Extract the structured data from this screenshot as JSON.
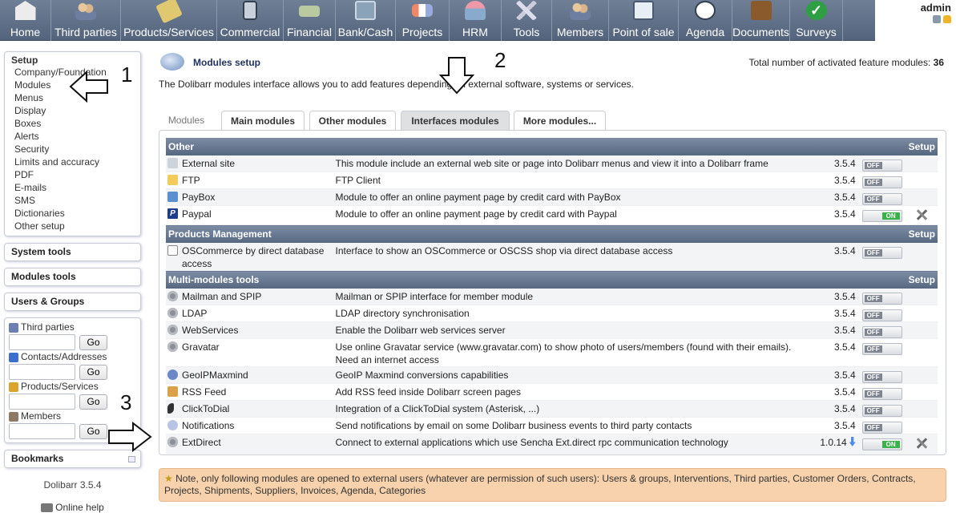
{
  "menu": [
    {
      "id": "home",
      "label": "Home",
      "icon": "home-icon",
      "width": 64
    },
    {
      "id": "third",
      "label": "Third parties",
      "icon": "third-parties-icon",
      "width": 87
    },
    {
      "id": "products",
      "label": "Products/Services",
      "icon": "products-icon",
      "width": 120
    },
    {
      "id": "commercial",
      "label": "Commercial",
      "icon": "commercial-icon",
      "width": 83
    },
    {
      "id": "financial",
      "label": "Financial",
      "icon": "financial-icon",
      "width": 65
    },
    {
      "id": "bank",
      "label": "Bank/Cash",
      "icon": "bank-icon",
      "width": 75
    },
    {
      "id": "projects",
      "label": "Projects",
      "icon": "projects-icon",
      "width": 67
    },
    {
      "id": "hrm",
      "label": "HRM",
      "icon": "hrm-icon",
      "width": 65
    },
    {
      "id": "tools",
      "label": "Tools",
      "icon": "tools-icon",
      "width": 63
    },
    {
      "id": "members",
      "label": "Members",
      "icon": "members-icon",
      "width": 71
    },
    {
      "id": "pos",
      "label": "Point of sale",
      "icon": "point-of-sale-icon",
      "width": 87
    },
    {
      "id": "agenda",
      "label": "Agenda",
      "icon": "agenda-icon",
      "width": 67
    },
    {
      "id": "documents",
      "label": "Documents",
      "icon": "documents-icon",
      "width": 72
    },
    {
      "id": "surveys",
      "label": "Surveys",
      "icon": "surveys-icon",
      "width": 66
    }
  ],
  "user": {
    "name": "admin"
  },
  "sidebar": {
    "setup_title": "Setup",
    "setup_items": [
      "Company/Foundation",
      "Modules",
      "Menus",
      "Display",
      "Boxes",
      "Alerts",
      "Security",
      "Limits and accuracy",
      "PDF",
      "E-mails",
      "SMS",
      "Dictionaries",
      "Other setup"
    ],
    "system_tools": "System tools",
    "modules_tools": "Modules tools",
    "users_groups": "Users & Groups",
    "search": [
      {
        "label": "Third parties",
        "icon": "third-parties-icon"
      },
      {
        "label": "Contacts/Addresses",
        "icon": "contacts-icon"
      },
      {
        "label": "Products/Services",
        "icon": "products-icon"
      },
      {
        "label": "Members",
        "icon": "members-icon"
      }
    ],
    "go_label": "Go",
    "bookmarks": "Bookmarks",
    "version": "Dolibarr 3.5.4",
    "help": "Online help"
  },
  "main": {
    "title": "Modules setup",
    "total_label": "Total number of activated feature modules:",
    "total_value": "36",
    "intro": "The Dolibarr modules interface allows you to add features depending on external software, systems or services.",
    "tabs": [
      {
        "label": "Modules",
        "state": "disabled"
      },
      {
        "label": "Main modules",
        "state": "normal"
      },
      {
        "label": "Other modules",
        "state": "normal"
      },
      {
        "label": "Interfaces modules",
        "state": "active"
      },
      {
        "label": "More modules...",
        "state": "normal"
      }
    ],
    "setup_label": "Setup",
    "groups": [
      {
        "name": "Other",
        "modules": [
          {
            "name": "External site",
            "icon": "external-site-icon",
            "desc": "This module include an external web site or page into Dolibarr menus and view it into a Dolibarr frame",
            "version": "3.5.4",
            "status": "OFF",
            "setup": false
          },
          {
            "name": "FTP",
            "icon": "ftp-folder-icon",
            "desc": "FTP Client",
            "version": "3.5.4",
            "status": "OFF",
            "setup": false
          },
          {
            "name": "PayBox",
            "icon": "paybox-icon",
            "desc": "Module to offer an online payment page by credit card with PayBox",
            "version": "3.5.4",
            "status": "OFF",
            "setup": false
          },
          {
            "name": "Paypal",
            "icon": "paypal-icon",
            "desc": "Module to offer an online payment page by credit card with Paypal",
            "version": "3.5.4",
            "status": "ON",
            "setup": true
          }
        ]
      },
      {
        "name": "Products Management",
        "modules": [
          {
            "name": "OSCommerce by direct database access",
            "icon": "page-icon",
            "desc": "Interface to show an OSCommerce or OSCSS shop via direct database access",
            "version": "3.5.4",
            "status": "OFF",
            "setup": false
          }
        ]
      },
      {
        "name": "Multi-modules tools",
        "modules": [
          {
            "name": "Mailman and SPIP",
            "icon": "gear-icon",
            "desc": "Mailman or SPIP interface for member module",
            "version": "3.5.4",
            "status": "OFF",
            "setup": false
          },
          {
            "name": "LDAP",
            "icon": "gear-icon",
            "desc": "LDAP directory synchronisation",
            "version": "3.5.4",
            "status": "OFF",
            "setup": false
          },
          {
            "name": "WebServices",
            "icon": "gear-icon",
            "desc": "Enable the Dolibarr web services server",
            "version": "3.5.4",
            "status": "OFF",
            "setup": false
          },
          {
            "name": "Gravatar",
            "icon": "gear-icon",
            "desc": "Use online Gravatar service (www.gravatar.com) to show photo of users/members (found with their emails). Need an internet access",
            "version": "3.5.4",
            "status": "OFF",
            "setup": false
          },
          {
            "name": "GeoIPMaxmind",
            "icon": "globe-icon",
            "desc": "GeoIP Maxmind conversions capabilities",
            "version": "3.5.4",
            "status": "OFF",
            "setup": false
          },
          {
            "name": "RSS Feed",
            "icon": "rss-icon",
            "desc": "Add RSS feed inside Dolibarr screen pages",
            "version": "3.5.4",
            "status": "OFF",
            "setup": false
          },
          {
            "name": "ClickToDial",
            "icon": "phone-icon",
            "desc": "Integration of a ClickToDial system (Asterisk, ...)",
            "version": "3.5.4",
            "status": "OFF",
            "setup": false
          },
          {
            "name": "Notifications",
            "icon": "notification-icon",
            "desc": "Send notifications by email on some Dolibarr business events to third party contacts",
            "version": "3.5.4",
            "status": "OFF",
            "setup": false
          },
          {
            "name": "ExtDirect",
            "icon": "gear-icon",
            "desc": "Connect to external applications which use Sencha Ext.direct rpc communication technology",
            "version": "1.0.14",
            "status": "ON",
            "setup": true,
            "update": true
          }
        ]
      }
    ],
    "note": "Note, only following modules are opened to external users (whatever are permission of such users): Users & groups, Interventions, Third parties, Customer Orders, Contracts, Projects, Shipments, Suppliers, Invoices, Agenda, Categories"
  },
  "annotations": [
    "1",
    "2",
    "3"
  ]
}
